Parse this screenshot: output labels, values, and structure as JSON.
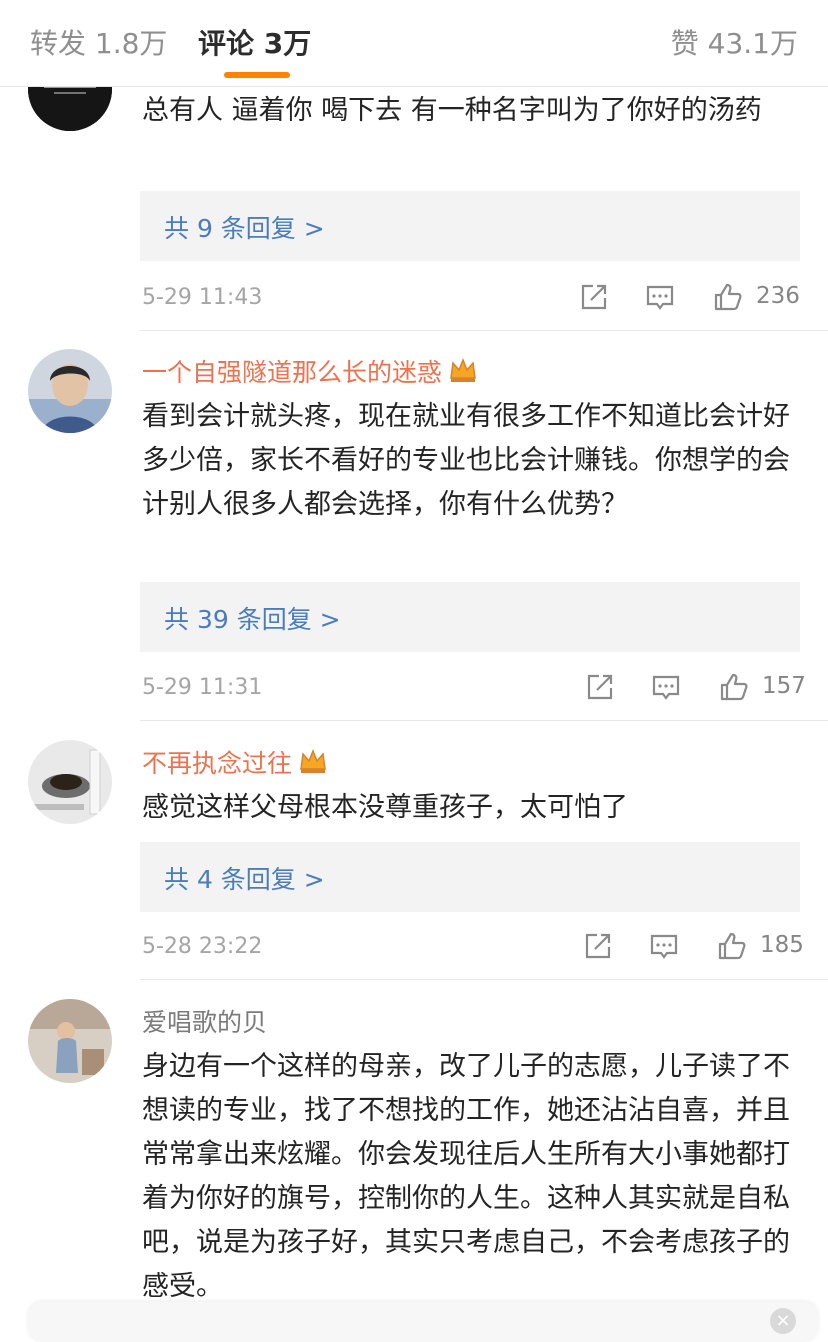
{
  "tabs": {
    "repost": "转发 1.8万",
    "comments": "评论 3万",
    "likes": "赞 43.1万"
  },
  "colors": {
    "accent": "#ff8200",
    "vip_name": "#eb7350",
    "link": "#4a7dbb"
  },
  "comments": [
    {
      "author": "",
      "text": "总有人 逼着你 喝下去 有一种名字叫为了你好的汤药",
      "replies": "共 9 条回复 >",
      "time": "5-29 11:43",
      "likes": "236"
    },
    {
      "author": "一个自强隧道那么长的迷惑",
      "vip_icon": "crown-icon",
      "text": "看到会计就头疼，现在就业有很多工作不知道比会计好多少倍，家长不看好的专业也比会计赚钱。你想学的会计别人很多人都会选择，你有什么优势？",
      "replies": "共 39 条回复 >",
      "time": "5-29 11:31",
      "likes": "157"
    },
    {
      "author": "不再执念过往",
      "vip_icon": "crown-icon",
      "text": "感觉这样父母根本没尊重孩子，太可怕了",
      "replies": "共 4 条回复 >",
      "time": "5-28 23:22",
      "likes": "185"
    },
    {
      "author": "爱唱歌的贝",
      "text": "身边有一个这样的母亲，改了儿子的志愿，儿子读了不想读的专业，找了不想找的工作，她还沾沾自喜，并且常常拿出来炫耀。你会发现往后人生所有大小事她都打着为你好的旗号，控制你的人生。这种人其实就是自私吧，说是为孩子好，其实只考虑自己，不会考虑孩子的感受。"
    }
  ],
  "close_label": "×"
}
